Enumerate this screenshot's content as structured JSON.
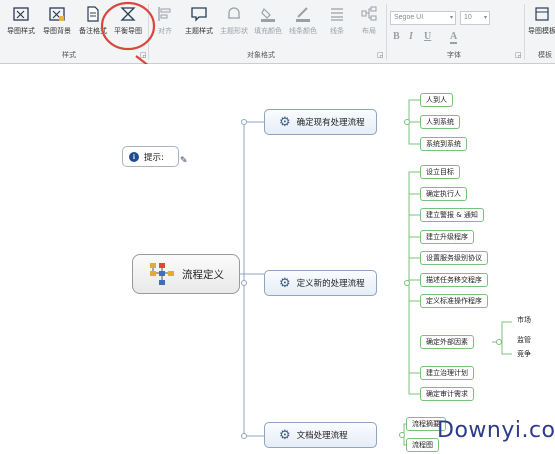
{
  "ribbon": {
    "buttons": [
      {
        "label": "导图样式",
        "icon": "map-style-icon"
      },
      {
        "label": "导图背景",
        "icon": "map-background-icon"
      },
      {
        "label": "备注格式",
        "icon": "note-format-icon"
      },
      {
        "label": "平衡导图",
        "icon": "balance-map-icon"
      },
      {
        "label": "对齐",
        "icon": "align-icon"
      },
      {
        "label": "主题样式",
        "icon": "topic-style-icon"
      },
      {
        "label": "主题形状",
        "icon": "topic-shape-icon"
      },
      {
        "label": "填充颜色",
        "icon": "fill-color-icon"
      },
      {
        "label": "线条颜色",
        "icon": "line-color-icon"
      },
      {
        "label": "线条",
        "icon": "lines-icon"
      },
      {
        "label": "布局",
        "icon": "layout-icon"
      },
      {
        "label": "导图模板",
        "icon": "map-template-icon"
      }
    ],
    "groups": [
      "样式",
      "对象格式",
      "字体",
      "模板"
    ],
    "font_name": "Segoe UI",
    "font_size": "10",
    "format_buttons": [
      "B",
      "I",
      "U",
      "A"
    ]
  },
  "canvas": {
    "root": "流程定义",
    "hint": "提示:",
    "branches": [
      {
        "label": "确定现有处理流程",
        "children": [
          "人到人",
          "人到系统",
          "系统到系统"
        ]
      },
      {
        "label": "定义新的处理流程",
        "children": [
          "设立目标",
          "确定执行人",
          "建立警报 & 通知",
          "建立升级程序",
          "设置服务级别协议",
          "描述任务移交程序",
          "定义标准操作程序",
          "确定外部因素",
          "建立治理计划",
          "确定审计需求"
        ]
      },
      {
        "label": "文档处理流程",
        "children": [
          "流程摘要",
          "流程图"
        ]
      }
    ],
    "external_factors": [
      "市场",
      "监管",
      "竞争"
    ]
  },
  "watermark": "Downyi.com",
  "colors": {
    "accent": "#d9463b",
    "leaf_border": "#7cc07e",
    "node_border": "#8ea4bf",
    "watermark": "#2e3b8c"
  }
}
